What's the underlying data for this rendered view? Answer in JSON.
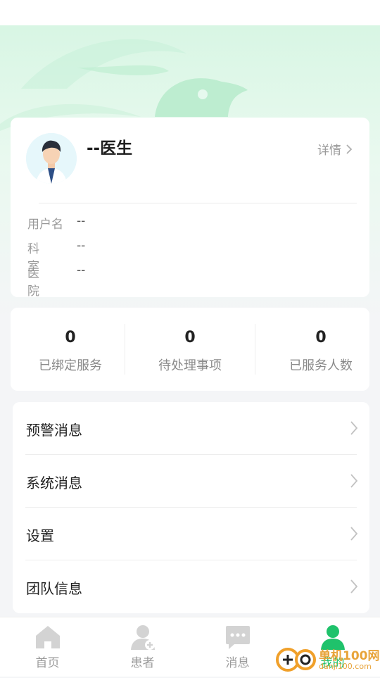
{
  "profile": {
    "doctor_name": "--医生",
    "detail_link": "详情",
    "fields": [
      {
        "label": "用户名",
        "value": "--"
      },
      {
        "label": "科室",
        "value": "--"
      },
      {
        "label": "医院",
        "value": "--"
      }
    ]
  },
  "stats": [
    {
      "value": "0",
      "label": "已绑定服务"
    },
    {
      "value": "0",
      "label": "待处理事项"
    },
    {
      "value": "0",
      "label": "已服务人数"
    }
  ],
  "menu": [
    {
      "label": "预警消息"
    },
    {
      "label": "系统消息"
    },
    {
      "label": "设置"
    },
    {
      "label": "团队信息"
    }
  ],
  "tabbar": [
    {
      "label": "首页",
      "icon": "home-icon"
    },
    {
      "label": "患者",
      "icon": "patient-icon"
    },
    {
      "label": "消息",
      "icon": "message-icon"
    },
    {
      "label": "我的",
      "icon": "profile-icon",
      "active": true
    }
  ],
  "watermark": {
    "brand": "单机100网",
    "url": "danji100.com"
  },
  "colors": {
    "accent": "#1fc26b",
    "hero": "#d8f6e4"
  }
}
